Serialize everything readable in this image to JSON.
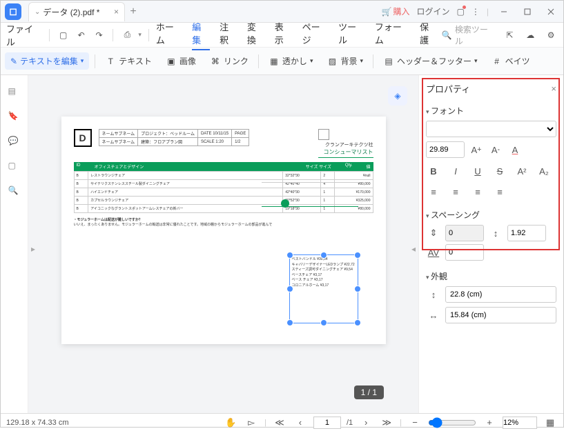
{
  "titlebar": {
    "tab_name": "データ (2).pdf *",
    "buy": "購入",
    "login": "ログイン"
  },
  "menu": {
    "file": "ファイル",
    "items": [
      "ホーム",
      "編集",
      "注釈",
      "変換",
      "表示",
      "ページ",
      "ツール",
      "フォーム",
      "保護"
    ],
    "active": "編集",
    "search_placeholder": "検索ツール"
  },
  "toolbar": {
    "edit_text": "テキストを編集",
    "text": "テキスト",
    "image": "画像",
    "link": "リンク",
    "watermark": "透かし",
    "background": "背景",
    "header_footer": "ヘッダー＆フッター",
    "bates": "ベイツ"
  },
  "document": {
    "d": "D",
    "meta": {
      "r1c1": "ネームサブネーム",
      "r1c2": "プロジェクト：ベッドルーム",
      "r1c3": "DATE 10/11/15",
      "r1c4": "PAGE",
      "r2c1": "ネームサブネーム",
      "r2c2": "建築：フロアプラン図",
      "r2c3": "SCALE 1:20",
      "r2c4": "1/2"
    },
    "company": "クランアーキテクツ社",
    "consumer": "コンシューマリスト",
    "hdr": {
      "c1": "ID",
      "c2": "オフィスチェアとデザイン",
      "c3": "サイズ サイズ",
      "c4": "Qty.",
      "c5": "値"
    },
    "rows": [
      {
        "id": "B",
        "name": "レストラウンジチェア",
        "size": "32*32*30",
        "qty": "2",
        "val": "¥null"
      },
      {
        "id": "B",
        "name": "サイテリクステンレススチール製ダイニングチェア",
        "size": "42*40*40",
        "qty": "4",
        "val": "¥80,000"
      },
      {
        "id": "B",
        "name": "ハイエンドチェア",
        "size": "42*40*30",
        "qty": "1",
        "val": "¥170,000"
      },
      {
        "id": "B",
        "name": "カプセルラウンジチェア",
        "size": "30*52*30",
        "qty": "1",
        "val": "¥325,000"
      },
      {
        "id": "B",
        "name": "アイコニックなグラントスポットアームレスチェアの新バー",
        "size": "19*18*30",
        "qty": "1",
        "val": "¥80,000"
      }
    ],
    "note_title": "・モジュラーホームは配送が難しいですか？",
    "note_body": "いいえ、まったくありません。モジュラーホームの輸送は非常に優れたことです。地域の棚からモジュラーホームの部品が進んで",
    "sel_items": [
      "ベストバンドル ¥30,54",
      "キャバリーデザイナーLEDランプ ¥22,72",
      "スティーズ調可ダイニングチェア ¥9,54",
      "ベースチェア ¥3,17",
      "ベース チェア ¥3,17",
      "コロニアルホーム ¥3,17"
    ]
  },
  "page_indicator": "1  /  1",
  "props": {
    "title": "プロパティ",
    "font_section": "フォント",
    "font_size": "29.89",
    "spacing_section": "スペーシング",
    "spacing1": "0",
    "spacing2": "1.92",
    "spacing3": "0",
    "appearance_section": "外観",
    "width": "22.8 (cm)",
    "height": "15.84 (cm)"
  },
  "status": {
    "coords": "129.18 x 74.33 cm",
    "page_current": "1",
    "page_total": "/1",
    "zoom": "12%"
  }
}
